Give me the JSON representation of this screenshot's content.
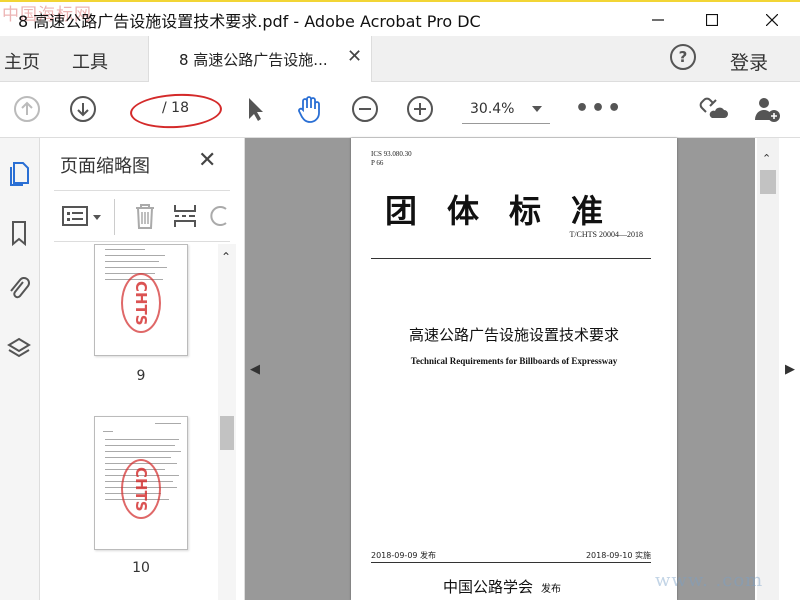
{
  "window": {
    "title": "8 高速公路广告设施设置技术要求.pdf - Adobe Acrobat Pro DC",
    "watermark_top": "中国海标网",
    "watermark_bottom": "www.       .com"
  },
  "tabs": {
    "home": "主页",
    "tools": "工具",
    "document": "8 高速公路广告设施...",
    "login": "登录"
  },
  "toolbar": {
    "current_page": "",
    "total_pages": "/ 18",
    "zoom": "30.4%"
  },
  "thumbnail_panel": {
    "title": "页面缩略图",
    "pages": [
      {
        "number": "9",
        "stamp": "CHTS"
      },
      {
        "number": "10",
        "stamp": "CHTS"
      }
    ]
  },
  "document_page": {
    "ics": "ICS 93.080.30",
    "p_code": "P 66",
    "heading": "团体标准",
    "standard_no": "T/CHTS 20004—2018",
    "cn_title": "高速公路广告设施设置技术要求",
    "en_title": "Technical Requirements for Billboards of Expressway",
    "publish_date": "2018-09-09  发布",
    "implement_date": "2018-09-10  实施",
    "publisher": "中国公路学会",
    "publisher_suffix": "发布"
  },
  "colors": {
    "accent": "#2a6fd4",
    "annotation": "#d42a2a",
    "frame": "#f2d535"
  }
}
